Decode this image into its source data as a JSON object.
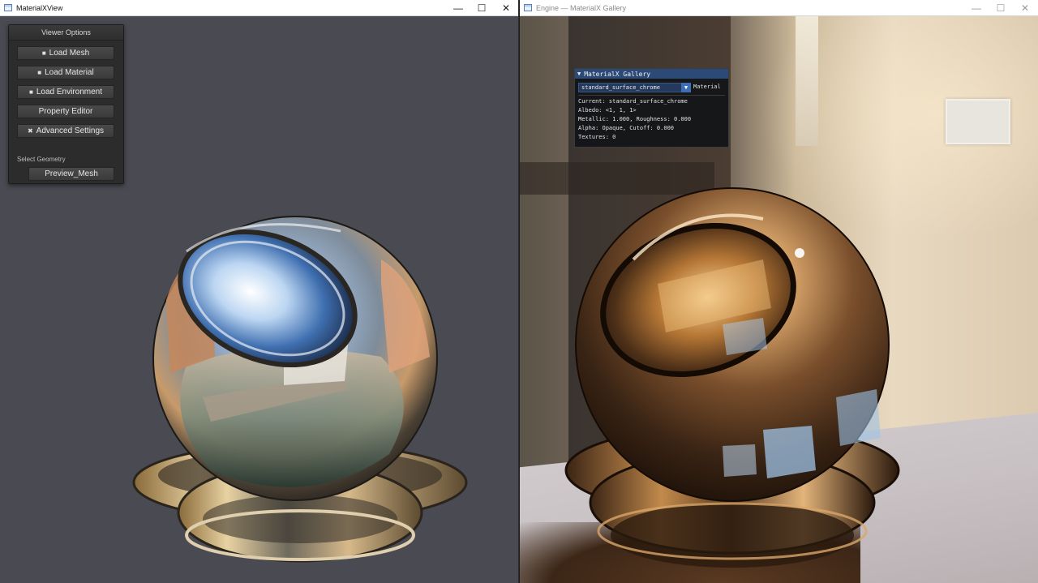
{
  "left_window": {
    "title": "MaterialXView",
    "controls": {
      "minimize": "—",
      "maximize": "☐",
      "close": "✕"
    },
    "viewer_options": {
      "header": "Viewer Options",
      "buttons": [
        {
          "icon": "folder-icon",
          "glyph": "■",
          "label": "Load Mesh"
        },
        {
          "icon": "folder-icon",
          "glyph": "■",
          "label": "Load Material"
        },
        {
          "icon": "folder-icon",
          "glyph": "■",
          "label": "Load Environment"
        },
        {
          "icon": "",
          "glyph": "",
          "label": "Property Editor"
        },
        {
          "icon": "tools-icon",
          "glyph": "✖",
          "label": "Advanced Settings"
        }
      ],
      "select_geometry_label": "Select Geometry",
      "geometry_button": "Preview_Mesh"
    }
  },
  "right_window": {
    "title": "Engine — MaterialX Gallery",
    "controls": {
      "minimize": "—",
      "maximize": "☐",
      "close": "✕"
    },
    "gallery": {
      "header": "MaterialX Gallery",
      "combo_value": "standard_surface_chrome",
      "combo_label": "Material",
      "lines": [
        "Current: standard_surface_chrome",
        "Albedo: <1, 1, 1>",
        "Metallic: 1.000, Roughness: 0.000",
        "Alpha: Opaque, Cutoff: 0.000",
        "Textures: 0"
      ]
    }
  },
  "colors": {
    "left_viewport": "#4a4a52",
    "gallery_header": "#2b4a78",
    "chrome_highlight": "#dfe9f5",
    "copper_tint": "#b5773d"
  }
}
